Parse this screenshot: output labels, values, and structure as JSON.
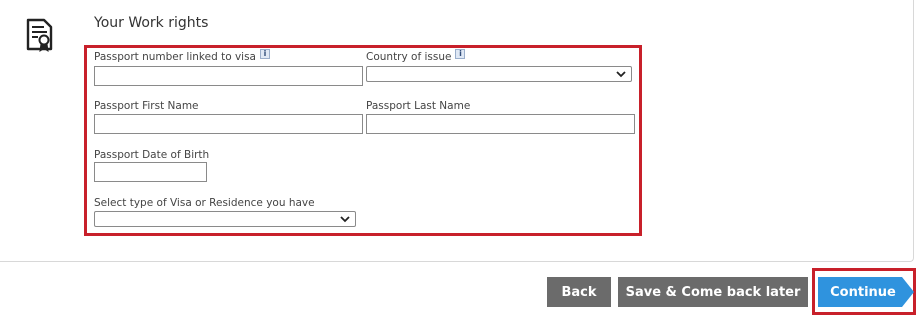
{
  "section": {
    "title": "Your Work rights",
    "icon": "certificate-document-icon"
  },
  "form": {
    "passport_number_label": "Passport number linked to visa",
    "passport_number_value": "",
    "country_label": "Country of issue",
    "country_selected": "",
    "first_name_label": "Passport First Name",
    "first_name_value": "",
    "last_name_label": "Passport Last Name",
    "last_name_value": "",
    "dob_label": "Passport Date of Birth",
    "dob_value": "",
    "visa_type_label": "Select type of Visa or Residence you have",
    "visa_type_selected": "",
    "info_badge_text": "i"
  },
  "actions": {
    "back_label": "Back",
    "save_label": "Save & Come back later",
    "continue_label": "Continue"
  },
  "colors": {
    "highlight": "#c8202a",
    "secondary_button": "#6b6b6b",
    "primary_button": "#2f93de"
  }
}
